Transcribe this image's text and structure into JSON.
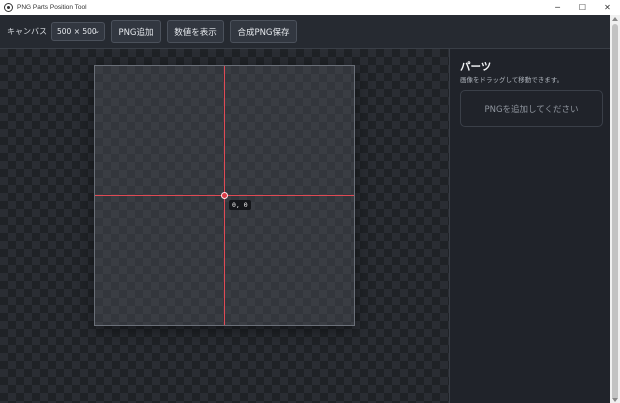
{
  "window": {
    "title": "PNG Parts Position Tool",
    "minimize": "─",
    "maximize": "☐",
    "close": "✕"
  },
  "toolbar": {
    "canvas_label": "キャンバス",
    "size_select": {
      "value": "500 × 500",
      "chevron": "⌄"
    },
    "add_png_label": "PNG追加",
    "show_values_label": "数値を表示",
    "save_composite_label": "合成PNG保存"
  },
  "canvas": {
    "coordinate_readout": "0, 0",
    "guide_color": "#e04a55"
  },
  "panel": {
    "title": "パーツ",
    "subtitle": "画像をドラッグして移動できます。",
    "empty_message": "PNGを追加してください"
  }
}
